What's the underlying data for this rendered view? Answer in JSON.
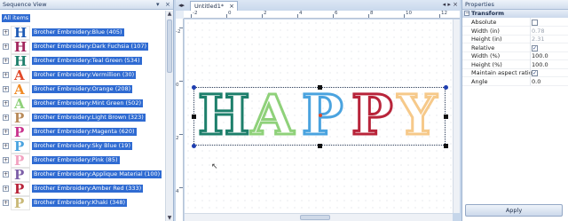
{
  "sequence": {
    "title": "Sequence View",
    "pin": "▾",
    "close": "×",
    "all_items": "All items",
    "items": [
      {
        "label": "Brother Embroidery:Blue (405)",
        "letter": "H",
        "color": "#1f5bb5"
      },
      {
        "label": "Brother Embroidery:Dark Fuchsia (107)",
        "letter": "H",
        "color": "#a3285e"
      },
      {
        "label": "Brother Embroidery:Teal Green (534)",
        "letter": "H",
        "color": "#1d7f6b"
      },
      {
        "label": "Brother Embroidery:Vermillion (30)",
        "letter": "A",
        "color": "#e2492a"
      },
      {
        "label": "Brother Embroidery:Orange (208)",
        "letter": "A",
        "color": "#f08a24"
      },
      {
        "label": "Brother Embroidery:Mint Green (502)",
        "letter": "A",
        "color": "#8fd17a"
      },
      {
        "label": "Brother Embroidery:Light Brown (323)",
        "letter": "P",
        "color": "#b88a58"
      },
      {
        "label": "Brother Embroidery:Magenta (620)",
        "letter": "P",
        "color": "#c9338d"
      },
      {
        "label": "Brother Embroidery:Sky Blue (19)",
        "letter": "P",
        "color": "#4aa3df"
      },
      {
        "label": "Brother Embroidery:Pink (85)",
        "letter": "P",
        "color": "#f2a2c0"
      },
      {
        "label": "Brother Embroidery:Applique Material (100)",
        "letter": "P",
        "color": "#7d5fa8"
      },
      {
        "label": "Brother Embroidery:Amber Red (333)",
        "letter": "P",
        "color": "#b8243a"
      },
      {
        "label": "Brother Embroidery:Khaki (348)",
        "letter": "P",
        "color": "#c9b877"
      }
    ]
  },
  "document": {
    "tab_label": "Untitled1*",
    "tab_close": "×",
    "ruler_top": [
      "-2",
      "0",
      "2",
      "4",
      "6",
      "8",
      "10",
      "12"
    ],
    "ruler_left": [
      "-2",
      "0",
      "2",
      "4"
    ],
    "word": [
      {
        "letter": "H",
        "color": "#1d7f6b"
      },
      {
        "letter": "A",
        "color": "#8fd17a"
      },
      {
        "letter": "P",
        "color": "#4aa3df"
      },
      {
        "letter": "P",
        "color": "#b8243a"
      },
      {
        "letter": "Y",
        "color": "#f6c98a"
      }
    ]
  },
  "properties": {
    "title": "Properties",
    "section": "Transform",
    "rows": [
      {
        "name": "Absolute",
        "type": "checkbox",
        "checked": false,
        "value": ""
      },
      {
        "name": "Width (in)",
        "type": "text",
        "value": "0.78",
        "dim": true
      },
      {
        "name": "Height (in)",
        "type": "text",
        "value": "2.31",
        "dim": true
      },
      {
        "name": "Relative",
        "type": "checkbox",
        "checked": true,
        "value": "✓"
      },
      {
        "name": "Width (%)",
        "type": "text",
        "value": "100.0"
      },
      {
        "name": "Height (%)",
        "type": "text",
        "value": "100.0"
      },
      {
        "name": "Maintain aspect ratio",
        "type": "checkbox",
        "checked": true,
        "value": "✓"
      },
      {
        "name": "Angle",
        "type": "text",
        "value": "0.0"
      }
    ],
    "apply_label": "Apply"
  }
}
